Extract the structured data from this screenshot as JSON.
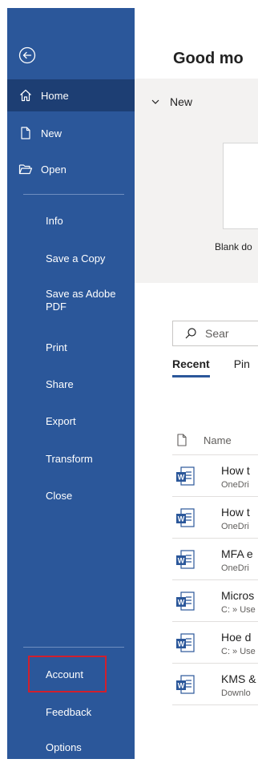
{
  "sidebar": {
    "items": [
      {
        "label": "Home",
        "icon": "home-icon",
        "active": true
      },
      {
        "label": "New",
        "icon": "new-document-icon"
      },
      {
        "label": "Open",
        "icon": "folder-open-icon"
      }
    ],
    "sub_items": [
      {
        "label": "Info"
      },
      {
        "label": "Save a Copy"
      },
      {
        "label": "Save as Adobe PDF"
      },
      {
        "label": "Print"
      },
      {
        "label": "Share"
      },
      {
        "label": "Export"
      },
      {
        "label": "Transform"
      },
      {
        "label": "Close"
      }
    ],
    "bottom_items": [
      {
        "label": "Account"
      },
      {
        "label": "Feedback"
      },
      {
        "label": "Options"
      }
    ],
    "background": "#2b579a",
    "highlight_color": "#d11f2d"
  },
  "main": {
    "greeting": "Good mo",
    "new_section": "New",
    "blank_label": "Blank do",
    "search_placeholder": "Sear",
    "tabs": [
      {
        "label": "Recent",
        "active": true
      },
      {
        "label": "Pin"
      }
    ],
    "column_name": "Name",
    "files": [
      {
        "name": "How t",
        "location": "OneDri"
      },
      {
        "name": "How t",
        "location": "OneDri"
      },
      {
        "name": "MFA e",
        "location": "OneDri"
      },
      {
        "name": "Micros",
        "location": "C: » Use"
      },
      {
        "name": "Hoe d",
        "location": "C: » Use"
      },
      {
        "name": "KMS &",
        "location": "Downlo"
      }
    ]
  }
}
